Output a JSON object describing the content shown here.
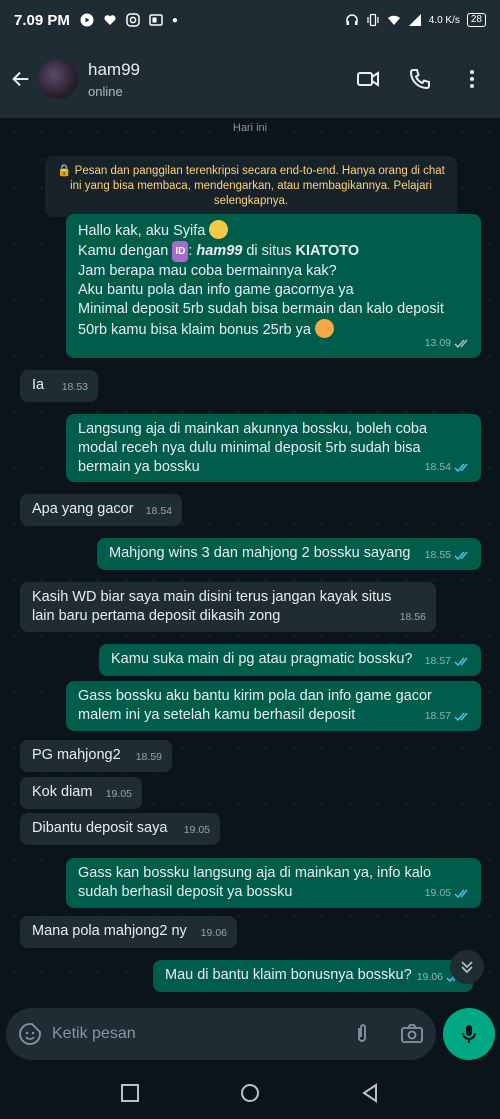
{
  "status": {
    "time": "7.09 PM",
    "network": "4.0 K/s",
    "battery": "28"
  },
  "header": {
    "name": "ham99",
    "status": "online"
  },
  "chat": {
    "date_label": "Hari ini",
    "encryption_notice": "🔒 Pesan dan panggilan terenkripsi secara end-to-end. Hanya orang di chat ini yang bisa membaca, mendengarkan, atau membagikannya. Pelajari selengkapnya.",
    "messages": [
      {
        "direction": "out",
        "time": "13.09",
        "read": true,
        "l1": "Hallo kak, aku Syifa",
        "l2a": "Kamu dengan ",
        "l2b": "ID",
        "l2c": ": ",
        "l2d": "ham99",
        "l2e": " di situs ",
        "l2f": "KIATOTO",
        "l3": "Jam berapa mau coba bermainnya kak?",
        "l4": "Aku bantu pola dan info game gacornya ya",
        "l5": "Minimal deposit 5rb sudah bisa bermain dan kalo deposit",
        "l6": "50rb kamu bisa klaim bonus 25rb ya"
      },
      {
        "direction": "in",
        "time": "18.53",
        "text": "Ia"
      },
      {
        "direction": "out",
        "time": "18.54",
        "read": true,
        "text": "Langsung aja di mainkan akunnya bossku, boleh coba modal receh nya dulu minimal deposit 5rb sudah bisa bermain ya bossku"
      },
      {
        "direction": "in",
        "time": "18.54",
        "text": "Apa yang gacor"
      },
      {
        "direction": "out",
        "time": "18.55",
        "read": true,
        "text": "Mahjong wins 3 dan mahjong 2 bossku sayang"
      },
      {
        "direction": "in",
        "time": "18.56",
        "text": "Kasih WD biar saya main disini terus jangan kayak situs lain baru pertama deposit dikasih zong"
      },
      {
        "direction": "out",
        "time": "18.57",
        "read": true,
        "text": "Kamu suka main di pg atau pragmatic bossku?"
      },
      {
        "direction": "out",
        "time": "18.57",
        "read": true,
        "text": "Gass bossku aku bantu kirim pola dan info game gacor malem ini ya setelah kamu berhasil deposit"
      },
      {
        "direction": "in",
        "time": "18.59",
        "text": "PG mahjong2"
      },
      {
        "direction": "in",
        "time": "19.05",
        "text": "Kok diam"
      },
      {
        "direction": "in",
        "time": "19.05",
        "text": "Dibantu deposit saya"
      },
      {
        "direction": "out",
        "time": "19.05",
        "read": true,
        "text": "Gass kan bossku langsung aja di mainkan ya, info kalo sudah berhasil deposit ya bossku"
      },
      {
        "direction": "in",
        "time": "19.06",
        "text": "Mana pola mahjong2 ny"
      },
      {
        "direction": "out",
        "time": "19.06",
        "read": true,
        "text": "Mau di bantu klaim bonusnya bossku?"
      }
    ]
  },
  "composer": {
    "placeholder": "Ketik pesan"
  },
  "colors": {
    "outgoing": "#005c4b",
    "incoming": "#202c33",
    "accent": "#00a884",
    "read_tick": "#53bdeb"
  }
}
